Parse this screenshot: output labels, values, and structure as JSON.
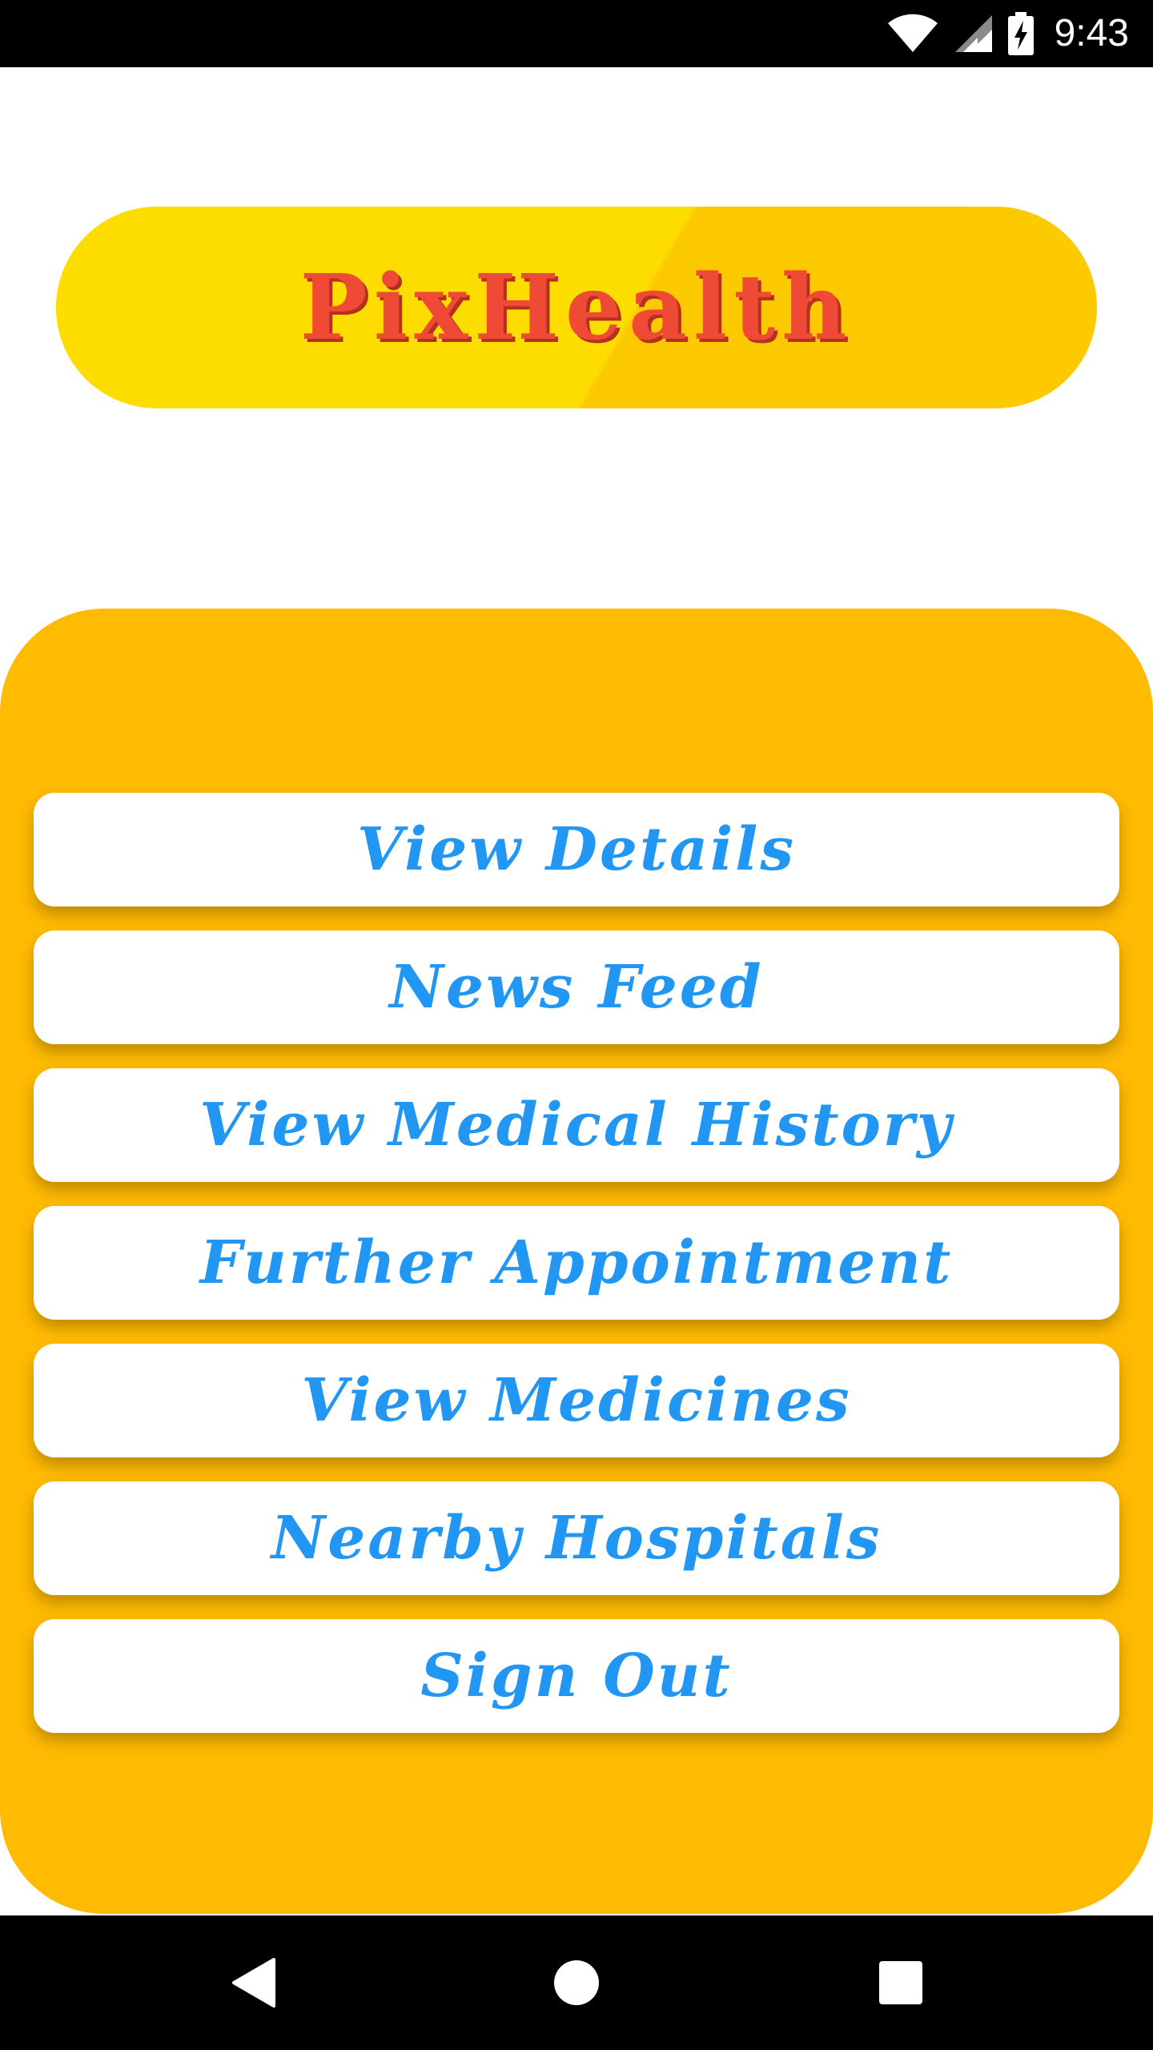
{
  "status_bar": {
    "time": "9:43",
    "icons": [
      "wifi-icon",
      "signal-icon",
      "battery-charging-icon"
    ]
  },
  "header": {
    "app_title": "PixHealth"
  },
  "menu": {
    "items": [
      {
        "label": "View Details"
      },
      {
        "label": "News Feed"
      },
      {
        "label": "View Medical History"
      },
      {
        "label": "Further Appointment"
      },
      {
        "label": "View Medicines"
      },
      {
        "label": "Nearby Hospitals"
      },
      {
        "label": "Sign Out"
      }
    ]
  },
  "nav_bar": {
    "icons": [
      "back-icon",
      "home-icon",
      "recents-icon"
    ]
  },
  "colors": {
    "panel": "#ffbb02",
    "banner": "#fddc00",
    "title": "#ee4a35",
    "button_text": "#2196f3"
  }
}
